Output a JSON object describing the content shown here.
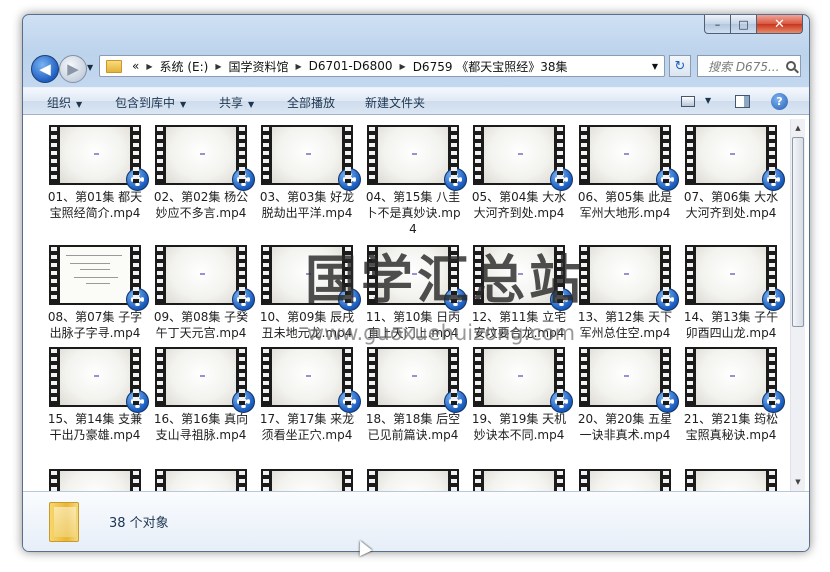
{
  "window": {
    "minimize": "–",
    "maximize": "□",
    "close": "✕"
  },
  "nav": {
    "back": "◀",
    "forward": "▶"
  },
  "address": {
    "prefix": "«",
    "crumbs": [
      "系统 (E:)",
      "国学资料馆",
      "D6701-D6800",
      "D6759 《都天宝照经》38集"
    ]
  },
  "search": {
    "placeholder": "搜索 D675..."
  },
  "toolbar": {
    "organize": "组织",
    "include": "包含到库中",
    "share": "共享",
    "play_all": "全部播放",
    "new_folder": "新建文件夹"
  },
  "files": [
    {
      "label": "01、第01集 都天宝照经简介.mp4"
    },
    {
      "label": "02、第02集 杨公妙应不多言.mp4"
    },
    {
      "label": "03、第03集 好龙脱劫出平洋.mp4"
    },
    {
      "label": "04、第15集 八圭卜不是真妙诀.mp4"
    },
    {
      "label": "05、第04集 大水大河齐到处.mp4"
    },
    {
      "label": "06、第05集 此是军州大地形.mp4"
    },
    {
      "label": "07、第06集 大水大河齐到处.mp4"
    },
    {
      "label": "08、第07集 子字出脉子字寻.mp4"
    },
    {
      "label": "09、第08集 子癸午丁天元宫.mp4"
    },
    {
      "label": "10、第09集 辰戌丑未地元龙.mp4"
    },
    {
      "label": "11、第10集 日丙直上天门上.mp4"
    },
    {
      "label": "12、第11集 立宅安坟要合龙.mp4"
    },
    {
      "label": "13、第12集 天下军州总住空.mp4"
    },
    {
      "label": "14、第13集 子午卯酉四山龙.mp4"
    },
    {
      "label": "15、第14集 支兼干出乃豪雄.mp4"
    },
    {
      "label": "16、第16集 真向支山寻祖脉.mp4"
    },
    {
      "label": "17、第17集 来龙须看坐正穴.mp4"
    },
    {
      "label": "18、第18集 后空已见前篇诀.mp4"
    },
    {
      "label": "19、第19集 天机妙诀本不同.mp4"
    },
    {
      "label": "20、第20集 五星一诀非真术.mp4"
    },
    {
      "label": "21、第21集 筠松宝照真秘诀.mp4"
    }
  ],
  "watermark": {
    "text": "国学汇总站",
    "url": "www.guoxuehuizong.com"
  },
  "details": {
    "count": "38 个对象"
  }
}
